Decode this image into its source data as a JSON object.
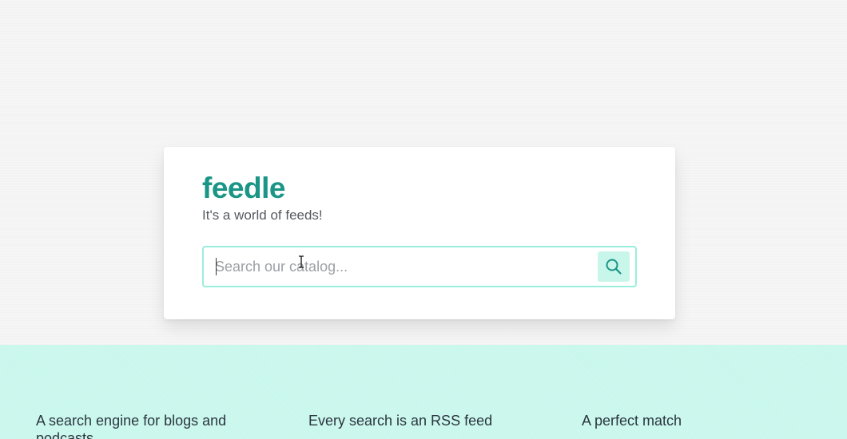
{
  "brand": {
    "name": "feedle",
    "tagline": "It's a world of feeds!"
  },
  "search": {
    "placeholder": "Search our catalog...",
    "value": "",
    "button_icon": "search-icon"
  },
  "features": [
    {
      "title": "A search engine for blogs and podcasts"
    },
    {
      "title": "Every search is an RSS feed"
    },
    {
      "title": "A perfect match"
    }
  ],
  "colors": {
    "brand": "#1a9586",
    "input_border": "#9aeedd",
    "button_bg": "#c8f6ea",
    "features_bg": "#c8f7ec"
  }
}
